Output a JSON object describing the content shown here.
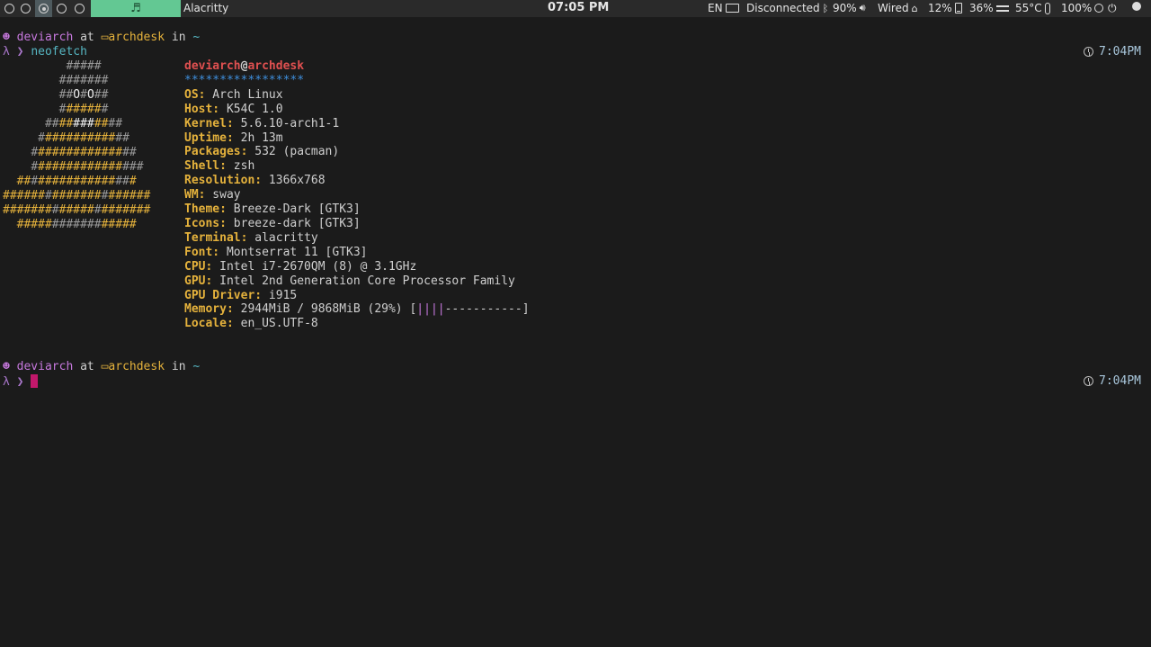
{
  "topbar": {
    "window_title": "Alacritty",
    "clock": "07:05 PM",
    "keyboard_layout": "EN",
    "bluetooth": "Disconnected",
    "volume": "90%",
    "network": "Wired",
    "cpu": "12%",
    "ram": "36%",
    "temperature": "55°C",
    "battery": "100%",
    "music_icon": "♬"
  },
  "prompt": {
    "user": "deviarch",
    "at": "at",
    "host": "archdesk",
    "in": "in",
    "dir": "~",
    "symbol": "λ ❯",
    "command": "neofetch",
    "time1": "7:04PM",
    "time2": "7:04PM"
  },
  "neofetch": {
    "user": "deviarch",
    "at_sign": "@",
    "host": "archdesk",
    "separator": "*****************",
    "rows": [
      {
        "key": "OS:",
        "value": " Arch Linux"
      },
      {
        "key": "Host:",
        "value": " K54C 1.0"
      },
      {
        "key": "Kernel:",
        "value": " 5.6.10-arch1-1"
      },
      {
        "key": "Uptime:",
        "value": " 2h 13m"
      },
      {
        "key": "Packages:",
        "value": " 532 (pacman)"
      },
      {
        "key": "Shell:",
        "value": " zsh"
      },
      {
        "key": "Resolution:",
        "value": " 1366x768"
      },
      {
        "key": "WM:",
        "value": " sway"
      },
      {
        "key": "Theme:",
        "value": " Breeze-Dark [GTK3]"
      },
      {
        "key": "Icons:",
        "value": " breeze-dark [GTK3]"
      },
      {
        "key": "Terminal:",
        "value": " alacritty"
      },
      {
        "key": "Font:",
        "value": " Montserrat 11 [GTK3]"
      },
      {
        "key": "CPU:",
        "value": " Intel i7-2670QM (8) @ 3.1GHz"
      },
      {
        "key": "GPU:",
        "value": " Intel 2nd Generation Core Processor Family"
      },
      {
        "key": "GPU Driver:",
        "value": " i915"
      }
    ],
    "memory_key": "Memory:",
    "memory_value": " 2944MiB / 9868MiB (29%) [",
    "memory_bar_used": "||||",
    "memory_bar_free": "-----------]",
    "locale_key": "Locale:",
    "locale_value": " en_US.UTF-8"
  }
}
